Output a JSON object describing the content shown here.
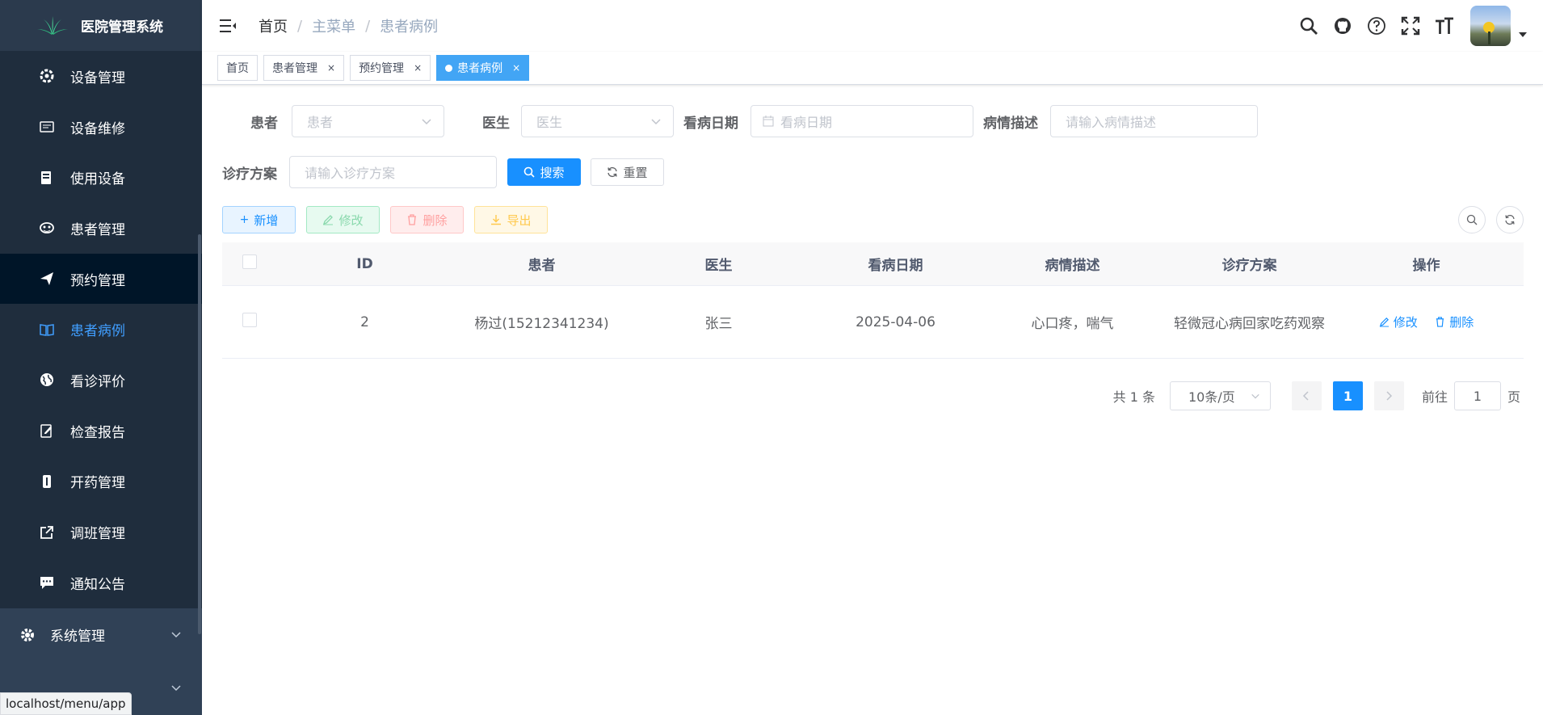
{
  "app": {
    "title": "医院管理系统"
  },
  "sidebar": {
    "items": [
      {
        "label": "设备管理",
        "icon": "settings-gear-icon"
      },
      {
        "label": "设备维修",
        "icon": "card-icon"
      },
      {
        "label": "使用设备",
        "icon": "device-icon"
      },
      {
        "label": "患者管理",
        "icon": "mask-icon"
      },
      {
        "label": "预约管理",
        "icon": "send-icon"
      },
      {
        "label": "患者病例",
        "icon": "book-icon"
      },
      {
        "label": "看诊评价",
        "icon": "globe-icon"
      },
      {
        "label": "检查报告",
        "icon": "edit-icon"
      },
      {
        "label": "开药管理",
        "icon": "pill-icon"
      },
      {
        "label": "调班管理",
        "icon": "external-link-icon"
      },
      {
        "label": "通知公告",
        "icon": "message-icon"
      }
    ],
    "system": {
      "label": "系统管理",
      "icon": "cog-icon"
    }
  },
  "status_url": "localhost/menu/app",
  "breadcrumb": [
    "首页",
    "主菜单",
    "患者病例"
  ],
  "tags": [
    {
      "label": "首页",
      "closable": false
    },
    {
      "label": "患者管理",
      "closable": true
    },
    {
      "label": "预约管理",
      "closable": true
    },
    {
      "label": "患者病例",
      "closable": true,
      "active": true
    }
  ],
  "tag_close": "×",
  "search": {
    "patient_label": "患者",
    "patient_placeholder": "患者",
    "doctor_label": "医生",
    "doctor_placeholder": "医生",
    "date_label": "看病日期",
    "date_placeholder": "看病日期",
    "desc_label": "病情描述",
    "desc_placeholder": "请输入病情描述",
    "plan_label": "诊疗方案",
    "plan_placeholder": "请输入诊疗方案",
    "search_btn": "搜索",
    "reset_btn": "重置"
  },
  "toolbar": {
    "add": "新增",
    "edit": "修改",
    "delete": "删除",
    "export": "导出"
  },
  "table": {
    "headers": [
      "ID",
      "患者",
      "医生",
      "看病日期",
      "病情描述",
      "诊疗方案",
      "操作"
    ],
    "rows": [
      {
        "id": "2",
        "patient": "杨过(15212341234)",
        "doctor": "张三",
        "date": "2025-04-06",
        "desc": "心口疼，喘气",
        "plan": "轻微冠心病回家吃药观察",
        "op_edit": "修改",
        "op_delete": "删除"
      }
    ]
  },
  "pagination": {
    "total_text": "共 1 条",
    "page_size": "10条/页",
    "current_page": "1",
    "goto_label": "前往",
    "goto_value": "1",
    "page_suffix": "页"
  },
  "colors": {
    "sidebar_bg": "#304156",
    "primary": "#1890ff",
    "tag_active": "#42a5f5"
  }
}
